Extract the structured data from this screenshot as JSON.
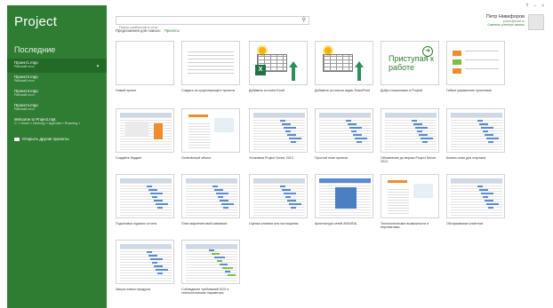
{
  "app": {
    "title": "Project"
  },
  "window_controls": [
    "?",
    "–",
    "×"
  ],
  "account": {
    "name": "Петр Никифоров",
    "email": "pnezh@mail.ru",
    "switch_label": "Сменить учетную запись"
  },
  "sidebar": {
    "recent_heading": "Последние",
    "recent": [
      {
        "name": "Проект1.mpp",
        "path": "Рабочий стол"
      },
      {
        "name": "Проект2.mpp",
        "path": "Рабочий стол"
      },
      {
        "name": "Проект3.mpp",
        "path": "Рабочий стол"
      },
      {
        "name": "Проект4.mpp",
        "path": "Рабочий стол"
      },
      {
        "name": "Welcome to Project.mpt",
        "path": "C: » Users » Nezhnyy » AppData » Roaming »"
      }
    ],
    "open_other": "Открыть другие проекты"
  },
  "search": {
    "placeholder": "Поиск шаблонов в сети",
    "suggest_label": "Предложения для поиска:",
    "suggestion": "Проекты"
  },
  "templates": [
    {
      "caption": "Новый проект",
      "art": "blank"
    },
    {
      "caption": "Создать из существующего проекта",
      "art": "lines"
    },
    {
      "caption": "Добавить из книги Excel",
      "art": "excel"
    },
    {
      "caption": "Добавить из списка задач SharePoint",
      "art": "sharepoint"
    },
    {
      "caption": "Добро пожаловать в Project!",
      "art": "welcome",
      "thumb_text": "Приступая к работе"
    },
    {
      "caption": "Гибкое управление проектами",
      "art": "agile"
    },
    {
      "caption": "Создайте бюджет",
      "art": "budget"
    },
    {
      "caption": "Оспенённый объект",
      "art": "report"
    },
    {
      "caption": "Установка Project Server 2013",
      "art": "gantt"
    },
    {
      "caption": "Простой план проекта",
      "art": "gantt"
    },
    {
      "caption": "Обновление до версии Project Server 2013",
      "art": "gantt"
    },
    {
      "caption": "Бизнес-план для стартапа",
      "art": "gantt"
    },
    {
      "caption": "Подготовка годового отчета",
      "art": "gantt"
    },
    {
      "caption": "План маркетинговой кампании",
      "art": "gantt"
    },
    {
      "caption": "Оценка слияния или поглощения",
      "art": "gantt"
    },
    {
      "caption": "Архитектура сетей ANSI/EIA",
      "art": "blue"
    },
    {
      "caption": "Технологические возможности и перспективы",
      "art": "report"
    },
    {
      "caption": "Обслуживание клиентов",
      "art": "gantt"
    },
    {
      "caption": "Запуск нового продукта",
      "art": "gantt"
    },
    {
      "caption": "Соблюдение требований SOX и технологические параметры",
      "art": "gantt-color"
    }
  ]
}
